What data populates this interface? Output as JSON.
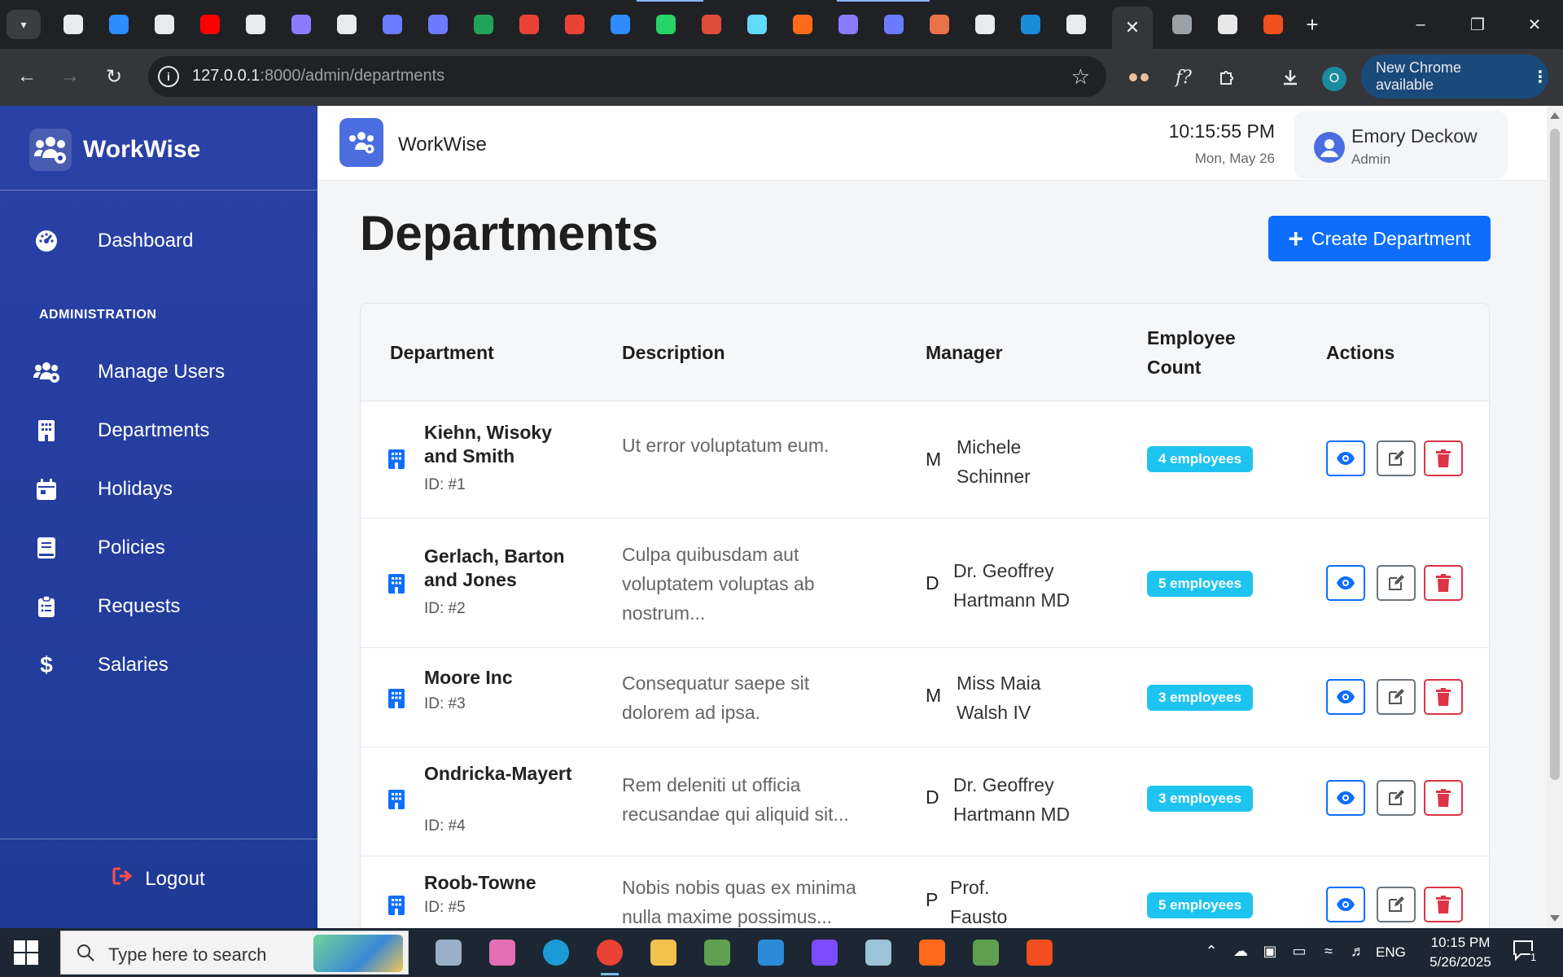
{
  "browser": {
    "url_host": "127.0.0.1",
    "url_path": ":8000/admin/departments",
    "update_label": "New Chrome available",
    "profile_letter": "O",
    "tab_favicon_colors": [
      "#e8eaed",
      "#2d8cff",
      "#e8eaed",
      "#ff0000",
      "#e8eaed",
      "#8b7bff",
      "#e8eaed",
      "#6b7bff",
      "#6b7bff",
      "#22a35a",
      "#ea4335",
      "#ea4335",
      "#2d8cff",
      "#25d366",
      "#e04c3a",
      "#61dafb",
      "#ff6a1a",
      "#8b7bff",
      "#6b7bff",
      "#e8734a",
      "#e8eaed",
      "#1b8cd8",
      "#e8eaed"
    ],
    "tab_after_colors": [
      "#9aa0a6",
      "#e8e8e8",
      "#f24e1e"
    ]
  },
  "app": {
    "brand": "WorkWise",
    "sidebar": {
      "dashboard": "Dashboard",
      "section": "ADMINISTRATION",
      "items": [
        "Manage Users",
        "Departments",
        "Holidays",
        "Policies",
        "Requests",
        "Salaries"
      ],
      "logout": "Logout"
    },
    "header": {
      "name": "WorkWise",
      "time": "10:15:55 PM",
      "date": "Mon, May 26",
      "user_name": "Emory Deckow",
      "user_role": "Admin"
    },
    "page_title": "Departments",
    "create_label": "Create Department",
    "table": {
      "headers": {
        "department": "Department",
        "description": "Description",
        "manager": "Manager",
        "count_line1": "Employee",
        "count_line2": "Count",
        "actions": "Actions"
      },
      "rows": [
        {
          "name": "Kiehn, Wisoky and Smith",
          "id": "ID: #1",
          "desc": "Ut error voluptatum eum.",
          "initial": "M",
          "manager": "Michele Schinner",
          "count": "4 employees"
        },
        {
          "name": "Gerlach, Barton and Jones",
          "id": "ID: #2",
          "desc": "Culpa quibusdam aut voluptatem voluptas ab nostrum...",
          "initial": "D",
          "manager": "Dr. Geoffrey Hartmann MD",
          "count": "5 employees"
        },
        {
          "name": "Moore Inc",
          "id": "ID: #3",
          "desc": "Consequatur saepe sit dolorem ad ipsa.",
          "initial": "M",
          "manager": "Miss Maia Walsh IV",
          "count": "3 employees"
        },
        {
          "name": "Ondricka-Mayert",
          "id": "ID: #4",
          "desc": "Rem deleniti ut officia recusandae qui aliquid sit...",
          "initial": "D",
          "manager": "Dr. Geoffrey Hartmann MD",
          "count": "3 employees"
        },
        {
          "name": "Roob-Towne",
          "id": "ID: #5",
          "desc": "Nobis nobis quas ex minima nulla maxime possimus...",
          "initial": "P",
          "manager": "Prof. Fausto Kreiger II",
          "count": "5 employees"
        }
      ]
    }
  },
  "taskbar": {
    "search_placeholder": "Type here to search",
    "lang": "ENG",
    "time": "10:15 PM",
    "date": "5/26/2025",
    "notif_count": "1",
    "app_colors": [
      "#9ab0c8",
      "#e46fb4",
      "#1a9bd7",
      "#ea4335",
      "#f2c14e",
      "#5fa04e",
      "#2b8bd8",
      "#7c4dff",
      "#9bc4d8",
      "#ff6a1a",
      "#5fa04e",
      "#f24e1e"
    ]
  },
  "colors": {
    "sidebar": "#2a41a6",
    "primary": "#0d6efd",
    "badge": "#1ec4f0",
    "danger": "#dc3545"
  }
}
